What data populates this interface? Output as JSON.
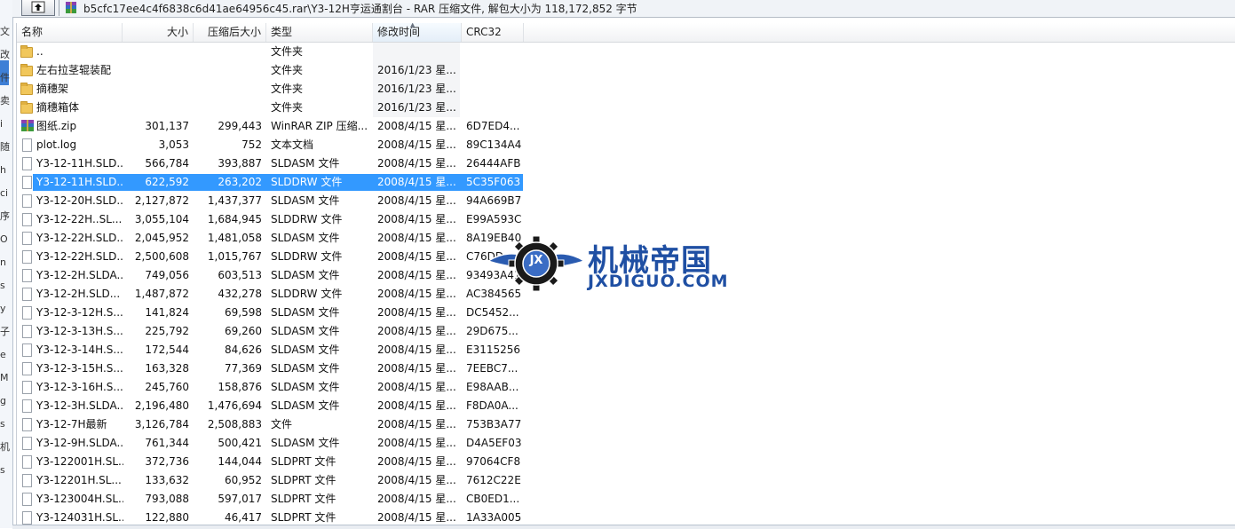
{
  "window": {
    "path": "b5cfc17ee4c4f6838c6d41ae64956c45.rar\\Y3-12H亨运通割台 - RAR 压缩文件, 解包大小为 118,172,852 字节"
  },
  "left_strip": [
    "文",
    "改",
    "件",
    "卖",
    "i",
    "随",
    "h",
    "ci",
    "序",
    "O",
    "n",
    "s",
    "y",
    "子",
    "e",
    "M",
    "g",
    "s",
    "机",
    "s"
  ],
  "columns": {
    "name": "名称",
    "size": "大小",
    "packed": "压缩后大小",
    "type": "类型",
    "modified": "修改时间",
    "crc": "CRC32"
  },
  "rows": [
    {
      "icon": "folder",
      "name": "..",
      "size": "",
      "packed": "",
      "type": "文件夹",
      "modified": "",
      "crc": ""
    },
    {
      "icon": "folder",
      "name": "左右拉茎辊装配",
      "size": "",
      "packed": "",
      "type": "文件夹",
      "modified": "2016/1/23 星...",
      "crc": ""
    },
    {
      "icon": "folder",
      "name": "摘穗架",
      "size": "",
      "packed": "",
      "type": "文件夹",
      "modified": "2016/1/23 星...",
      "crc": ""
    },
    {
      "icon": "folder",
      "name": "摘穗箱体",
      "size": "",
      "packed": "",
      "type": "文件夹",
      "modified": "2016/1/23 星...",
      "crc": ""
    },
    {
      "icon": "zip",
      "name": "图纸.zip",
      "size": "301,137",
      "packed": "299,443",
      "type": "WinRAR ZIP 压缩...",
      "modified": "2008/4/15 星...",
      "crc": "6D7ED4..."
    },
    {
      "icon": "file",
      "name": "plot.log",
      "size": "3,053",
      "packed": "752",
      "type": "文本文档",
      "modified": "2008/4/15 星...",
      "crc": "89C134A4"
    },
    {
      "icon": "file",
      "name": "Y3-12-11H.SLD...",
      "size": "566,784",
      "packed": "393,887",
      "type": "SLDASM 文件",
      "modified": "2008/4/15 星...",
      "crc": "26444AFB"
    },
    {
      "icon": "file",
      "name": "Y3-12-11H.SLD...",
      "size": "622,592",
      "packed": "263,202",
      "type": "SLDDRW 文件",
      "modified": "2008/4/15 星...",
      "crc": "5C35F063",
      "selected": true
    },
    {
      "icon": "file",
      "name": "Y3-12-20H.SLD...",
      "size": "2,127,872",
      "packed": "1,437,377",
      "type": "SLDASM 文件",
      "modified": "2008/4/15 星...",
      "crc": "94A669B7"
    },
    {
      "icon": "file",
      "name": "Y3-12-22H..SL...",
      "size": "3,055,104",
      "packed": "1,684,945",
      "type": "SLDDRW 文件",
      "modified": "2008/4/15 星...",
      "crc": "E99A593C"
    },
    {
      "icon": "file",
      "name": "Y3-12-22H.SLD...",
      "size": "2,045,952",
      "packed": "1,481,058",
      "type": "SLDASM 文件",
      "modified": "2008/4/15 星...",
      "crc": "8A19EB40"
    },
    {
      "icon": "file",
      "name": "Y3-12-22H.SLD...",
      "size": "2,500,608",
      "packed": "1,015,767",
      "type": "SLDDRW 文件",
      "modified": "2008/4/15 星...",
      "crc": "C76DD..."
    },
    {
      "icon": "file",
      "name": "Y3-12-2H.SLDA...",
      "size": "749,056",
      "packed": "603,513",
      "type": "SLDASM 文件",
      "modified": "2008/4/15 星...",
      "crc": "93493A41"
    },
    {
      "icon": "file",
      "name": "Y3-12-2H.SLD...",
      "size": "1,487,872",
      "packed": "432,278",
      "type": "SLDDRW 文件",
      "modified": "2008/4/15 星...",
      "crc": "AC384565"
    },
    {
      "icon": "file",
      "name": "Y3-12-3-12H.S...",
      "size": "141,824",
      "packed": "69,598",
      "type": "SLDASM 文件",
      "modified": "2008/4/15 星...",
      "crc": "DC5452..."
    },
    {
      "icon": "file",
      "name": "Y3-12-3-13H.S...",
      "size": "225,792",
      "packed": "69,260",
      "type": "SLDASM 文件",
      "modified": "2008/4/15 星...",
      "crc": "29D675..."
    },
    {
      "icon": "file",
      "name": "Y3-12-3-14H.S...",
      "size": "172,544",
      "packed": "84,626",
      "type": "SLDASM 文件",
      "modified": "2008/4/15 星...",
      "crc": "E3115256"
    },
    {
      "icon": "file",
      "name": "Y3-12-3-15H.S...",
      "size": "163,328",
      "packed": "77,369",
      "type": "SLDASM 文件",
      "modified": "2008/4/15 星...",
      "crc": "7EEBC7..."
    },
    {
      "icon": "file",
      "name": "Y3-12-3-16H.S...",
      "size": "245,760",
      "packed": "158,876",
      "type": "SLDASM 文件",
      "modified": "2008/4/15 星...",
      "crc": "E98AAB..."
    },
    {
      "icon": "file",
      "name": "Y3-12-3H.SLDA...",
      "size": "2,196,480",
      "packed": "1,476,694",
      "type": "SLDASM 文件",
      "modified": "2008/4/15 星...",
      "crc": "F8DA0A..."
    },
    {
      "icon": "file",
      "name": "Y3-12-7H最新",
      "size": "3,126,784",
      "packed": "2,508,883",
      "type": "文件",
      "modified": "2008/4/15 星...",
      "crc": "753B3A77"
    },
    {
      "icon": "file",
      "name": "Y3-12-9H.SLDA...",
      "size": "761,344",
      "packed": "500,421",
      "type": "SLDASM 文件",
      "modified": "2008/4/15 星...",
      "crc": "D4A5EF03"
    },
    {
      "icon": "file",
      "name": "Y3-122001H.SL...",
      "size": "372,736",
      "packed": "144,044",
      "type": "SLDPRT 文件",
      "modified": "2008/4/15 星...",
      "crc": "97064CF8"
    },
    {
      "icon": "file",
      "name": "Y3-12201H.SL...",
      "size": "133,632",
      "packed": "60,952",
      "type": "SLDPRT 文件",
      "modified": "2008/4/15 星...",
      "crc": "7612C22E"
    },
    {
      "icon": "file",
      "name": "Y3-123004H.SL...",
      "size": "793,088",
      "packed": "597,017",
      "type": "SLDPRT 文件",
      "modified": "2008/4/15 星...",
      "crc": "CB0ED1..."
    },
    {
      "icon": "file",
      "name": "Y3-124031H.SL...",
      "size": "122,880",
      "packed": "46,417",
      "type": "SLDPRT 文件",
      "modified": "2008/4/15 星...",
      "crc": "1A33A005"
    }
  ],
  "watermark": {
    "logo_text": "JX",
    "title_cn": "机械帝国",
    "title_en": "JXDIGUO.COM"
  },
  "colors": {
    "selection": "#3399ff",
    "folder": "#f1c75b",
    "watermark": "#1f4fa3"
  }
}
